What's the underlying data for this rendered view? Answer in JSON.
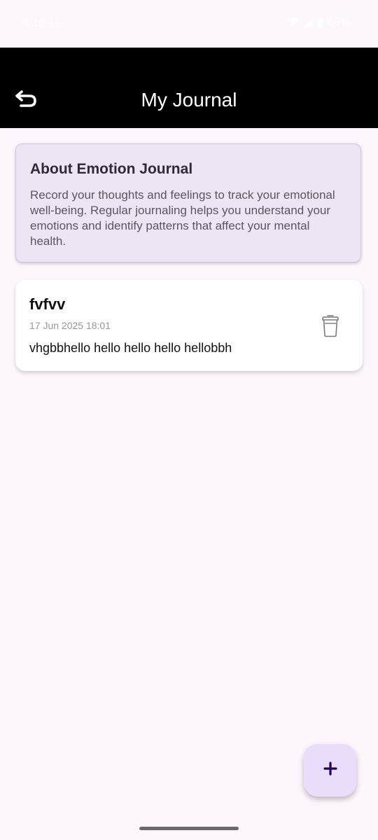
{
  "status_bar": {
    "time": "4:15 ☷",
    "battery": "68%"
  },
  "app_bar": {
    "title": "My Journal",
    "back_icon": "back-arrow-icon"
  },
  "info_card": {
    "title": "About Emotion Journal",
    "text": "Record your thoughts and feelings to track your emotional well-being. Regular journaling helps you understand your emotions and identify patterns that affect your mental health."
  },
  "entries": [
    {
      "title": "fvfvv",
      "date": "17 Jun 2025 18:01",
      "body": "vhgbbhello hello hello hello hellobbh",
      "delete_icon": "trash-icon"
    }
  ],
  "fab": {
    "icon": "plus-icon"
  },
  "colors": {
    "background": "#fdf6fd",
    "app_bar": "#000000",
    "info_card": "#ede5f4",
    "fab": "#eadcfb",
    "fab_icon": "#21005d"
  }
}
